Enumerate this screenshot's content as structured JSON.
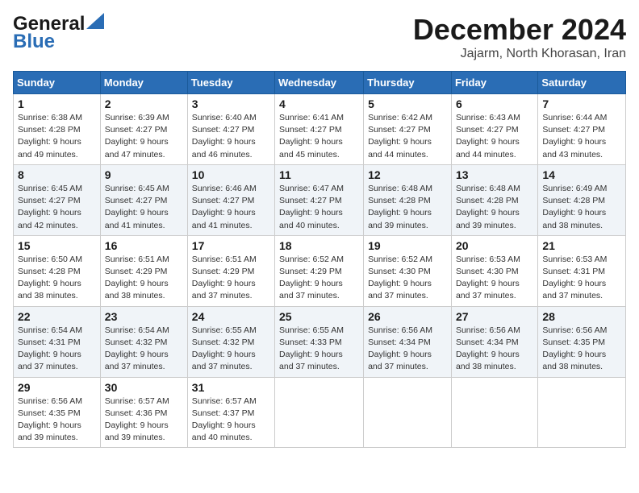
{
  "logo": {
    "line1": "General",
    "line2": "Blue"
  },
  "title": "December 2024",
  "subtitle": "Jajarm, North Khorasan, Iran",
  "days_header": [
    "Sunday",
    "Monday",
    "Tuesday",
    "Wednesday",
    "Thursday",
    "Friday",
    "Saturday"
  ],
  "weeks": [
    [
      {
        "day": "1",
        "sunrise": "6:38 AM",
        "sunset": "4:28 PM",
        "daylight": "9 hours and 49 minutes."
      },
      {
        "day": "2",
        "sunrise": "6:39 AM",
        "sunset": "4:27 PM",
        "daylight": "9 hours and 47 minutes."
      },
      {
        "day": "3",
        "sunrise": "6:40 AM",
        "sunset": "4:27 PM",
        "daylight": "9 hours and 46 minutes."
      },
      {
        "day": "4",
        "sunrise": "6:41 AM",
        "sunset": "4:27 PM",
        "daylight": "9 hours and 45 minutes."
      },
      {
        "day": "5",
        "sunrise": "6:42 AM",
        "sunset": "4:27 PM",
        "daylight": "9 hours and 44 minutes."
      },
      {
        "day": "6",
        "sunrise": "6:43 AM",
        "sunset": "4:27 PM",
        "daylight": "9 hours and 44 minutes."
      },
      {
        "day": "7",
        "sunrise": "6:44 AM",
        "sunset": "4:27 PM",
        "daylight": "9 hours and 43 minutes."
      }
    ],
    [
      {
        "day": "8",
        "sunrise": "6:45 AM",
        "sunset": "4:27 PM",
        "daylight": "9 hours and 42 minutes."
      },
      {
        "day": "9",
        "sunrise": "6:45 AM",
        "sunset": "4:27 PM",
        "daylight": "9 hours and 41 minutes."
      },
      {
        "day": "10",
        "sunrise": "6:46 AM",
        "sunset": "4:27 PM",
        "daylight": "9 hours and 41 minutes."
      },
      {
        "day": "11",
        "sunrise": "6:47 AM",
        "sunset": "4:27 PM",
        "daylight": "9 hours and 40 minutes."
      },
      {
        "day": "12",
        "sunrise": "6:48 AM",
        "sunset": "4:28 PM",
        "daylight": "9 hours and 39 minutes."
      },
      {
        "day": "13",
        "sunrise": "6:48 AM",
        "sunset": "4:28 PM",
        "daylight": "9 hours and 39 minutes."
      },
      {
        "day": "14",
        "sunrise": "6:49 AM",
        "sunset": "4:28 PM",
        "daylight": "9 hours and 38 minutes."
      }
    ],
    [
      {
        "day": "15",
        "sunrise": "6:50 AM",
        "sunset": "4:28 PM",
        "daylight": "9 hours and 38 minutes."
      },
      {
        "day": "16",
        "sunrise": "6:51 AM",
        "sunset": "4:29 PM",
        "daylight": "9 hours and 38 minutes."
      },
      {
        "day": "17",
        "sunrise": "6:51 AM",
        "sunset": "4:29 PM",
        "daylight": "9 hours and 37 minutes."
      },
      {
        "day": "18",
        "sunrise": "6:52 AM",
        "sunset": "4:29 PM",
        "daylight": "9 hours and 37 minutes."
      },
      {
        "day": "19",
        "sunrise": "6:52 AM",
        "sunset": "4:30 PM",
        "daylight": "9 hours and 37 minutes."
      },
      {
        "day": "20",
        "sunrise": "6:53 AM",
        "sunset": "4:30 PM",
        "daylight": "9 hours and 37 minutes."
      },
      {
        "day": "21",
        "sunrise": "6:53 AM",
        "sunset": "4:31 PM",
        "daylight": "9 hours and 37 minutes."
      }
    ],
    [
      {
        "day": "22",
        "sunrise": "6:54 AM",
        "sunset": "4:31 PM",
        "daylight": "9 hours and 37 minutes."
      },
      {
        "day": "23",
        "sunrise": "6:54 AM",
        "sunset": "4:32 PM",
        "daylight": "9 hours and 37 minutes."
      },
      {
        "day": "24",
        "sunrise": "6:55 AM",
        "sunset": "4:32 PM",
        "daylight": "9 hours and 37 minutes."
      },
      {
        "day": "25",
        "sunrise": "6:55 AM",
        "sunset": "4:33 PM",
        "daylight": "9 hours and 37 minutes."
      },
      {
        "day": "26",
        "sunrise": "6:56 AM",
        "sunset": "4:34 PM",
        "daylight": "9 hours and 37 minutes."
      },
      {
        "day": "27",
        "sunrise": "6:56 AM",
        "sunset": "4:34 PM",
        "daylight": "9 hours and 38 minutes."
      },
      {
        "day": "28",
        "sunrise": "6:56 AM",
        "sunset": "4:35 PM",
        "daylight": "9 hours and 38 minutes."
      }
    ],
    [
      {
        "day": "29",
        "sunrise": "6:56 AM",
        "sunset": "4:35 PM",
        "daylight": "9 hours and 39 minutes."
      },
      {
        "day": "30",
        "sunrise": "6:57 AM",
        "sunset": "4:36 PM",
        "daylight": "9 hours and 39 minutes."
      },
      {
        "day": "31",
        "sunrise": "6:57 AM",
        "sunset": "4:37 PM",
        "daylight": "9 hours and 40 minutes."
      },
      null,
      null,
      null,
      null
    ]
  ]
}
